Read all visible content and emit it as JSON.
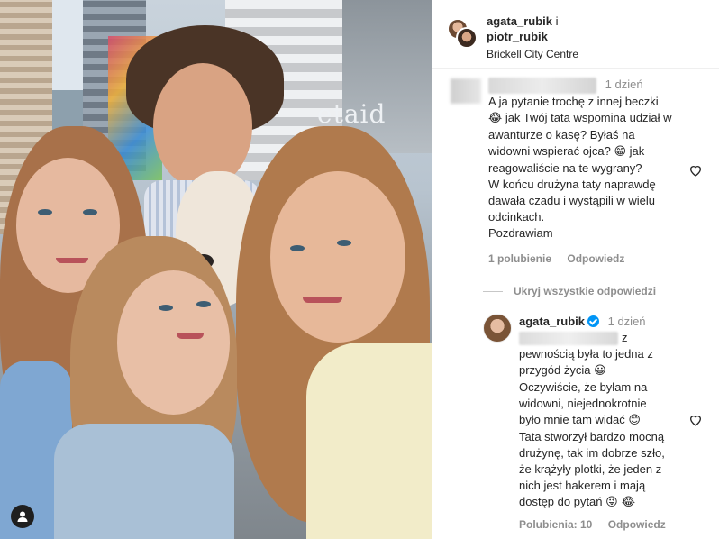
{
  "post": {
    "author1": "agata_rubik",
    "connector": "i",
    "author2": "piotr_rubik",
    "location": "Brickell City Centre",
    "photo_sign_text": "etaid"
  },
  "comment1": {
    "time": "1 dzień",
    "line1": "A ja pytanie trochę z innej beczki",
    "line2a": "😂",
    "line2b": " jak Twój tata wspomina udział w",
    "line3": "awanturze o kasę? Byłaś na",
    "line4": "widowni wspierać ojca?",
    "line4emoji": "😁",
    "line4b": " jak",
    "line5": "reagowaliście na te wygrany?",
    "line6": "W końcu drużyna taty naprawdę",
    "line7": "dawała czadu i wystąpili w wielu",
    "line8": "odcinkach.",
    "line9": "Pozdrawiam",
    "likes": "1 polubienie",
    "reply": "Odpowiedz"
  },
  "hide_replies": "Ukryj wszystkie odpowiedzi",
  "reply1": {
    "author": "agata_rubik",
    "time": "1 dzień",
    "l1": "z",
    "l2": "pewnością była to jedna z",
    "l3": "przygód życia",
    "l3emoji": "😀",
    "l4": "Oczywiście, że byłam na",
    "l5": "widowni, niejednokrotnie",
    "l6": "było mnie tam widać",
    "l6emoji": "😊",
    "l7": "Tata stworzył bardzo mocną",
    "l8": "drużynę, tak im dobrze szło,",
    "l9": "że krążyły plotki, że jeden z",
    "l10": "nich jest hakerem i mają",
    "l11": "dostęp do pytań",
    "l11emoji": "😜 😂",
    "likes": "Polubienia: 10",
    "reply": "Odpowiedz"
  },
  "icons": [
    "heart-icon",
    "verified-icon",
    "user-tag-icon"
  ]
}
